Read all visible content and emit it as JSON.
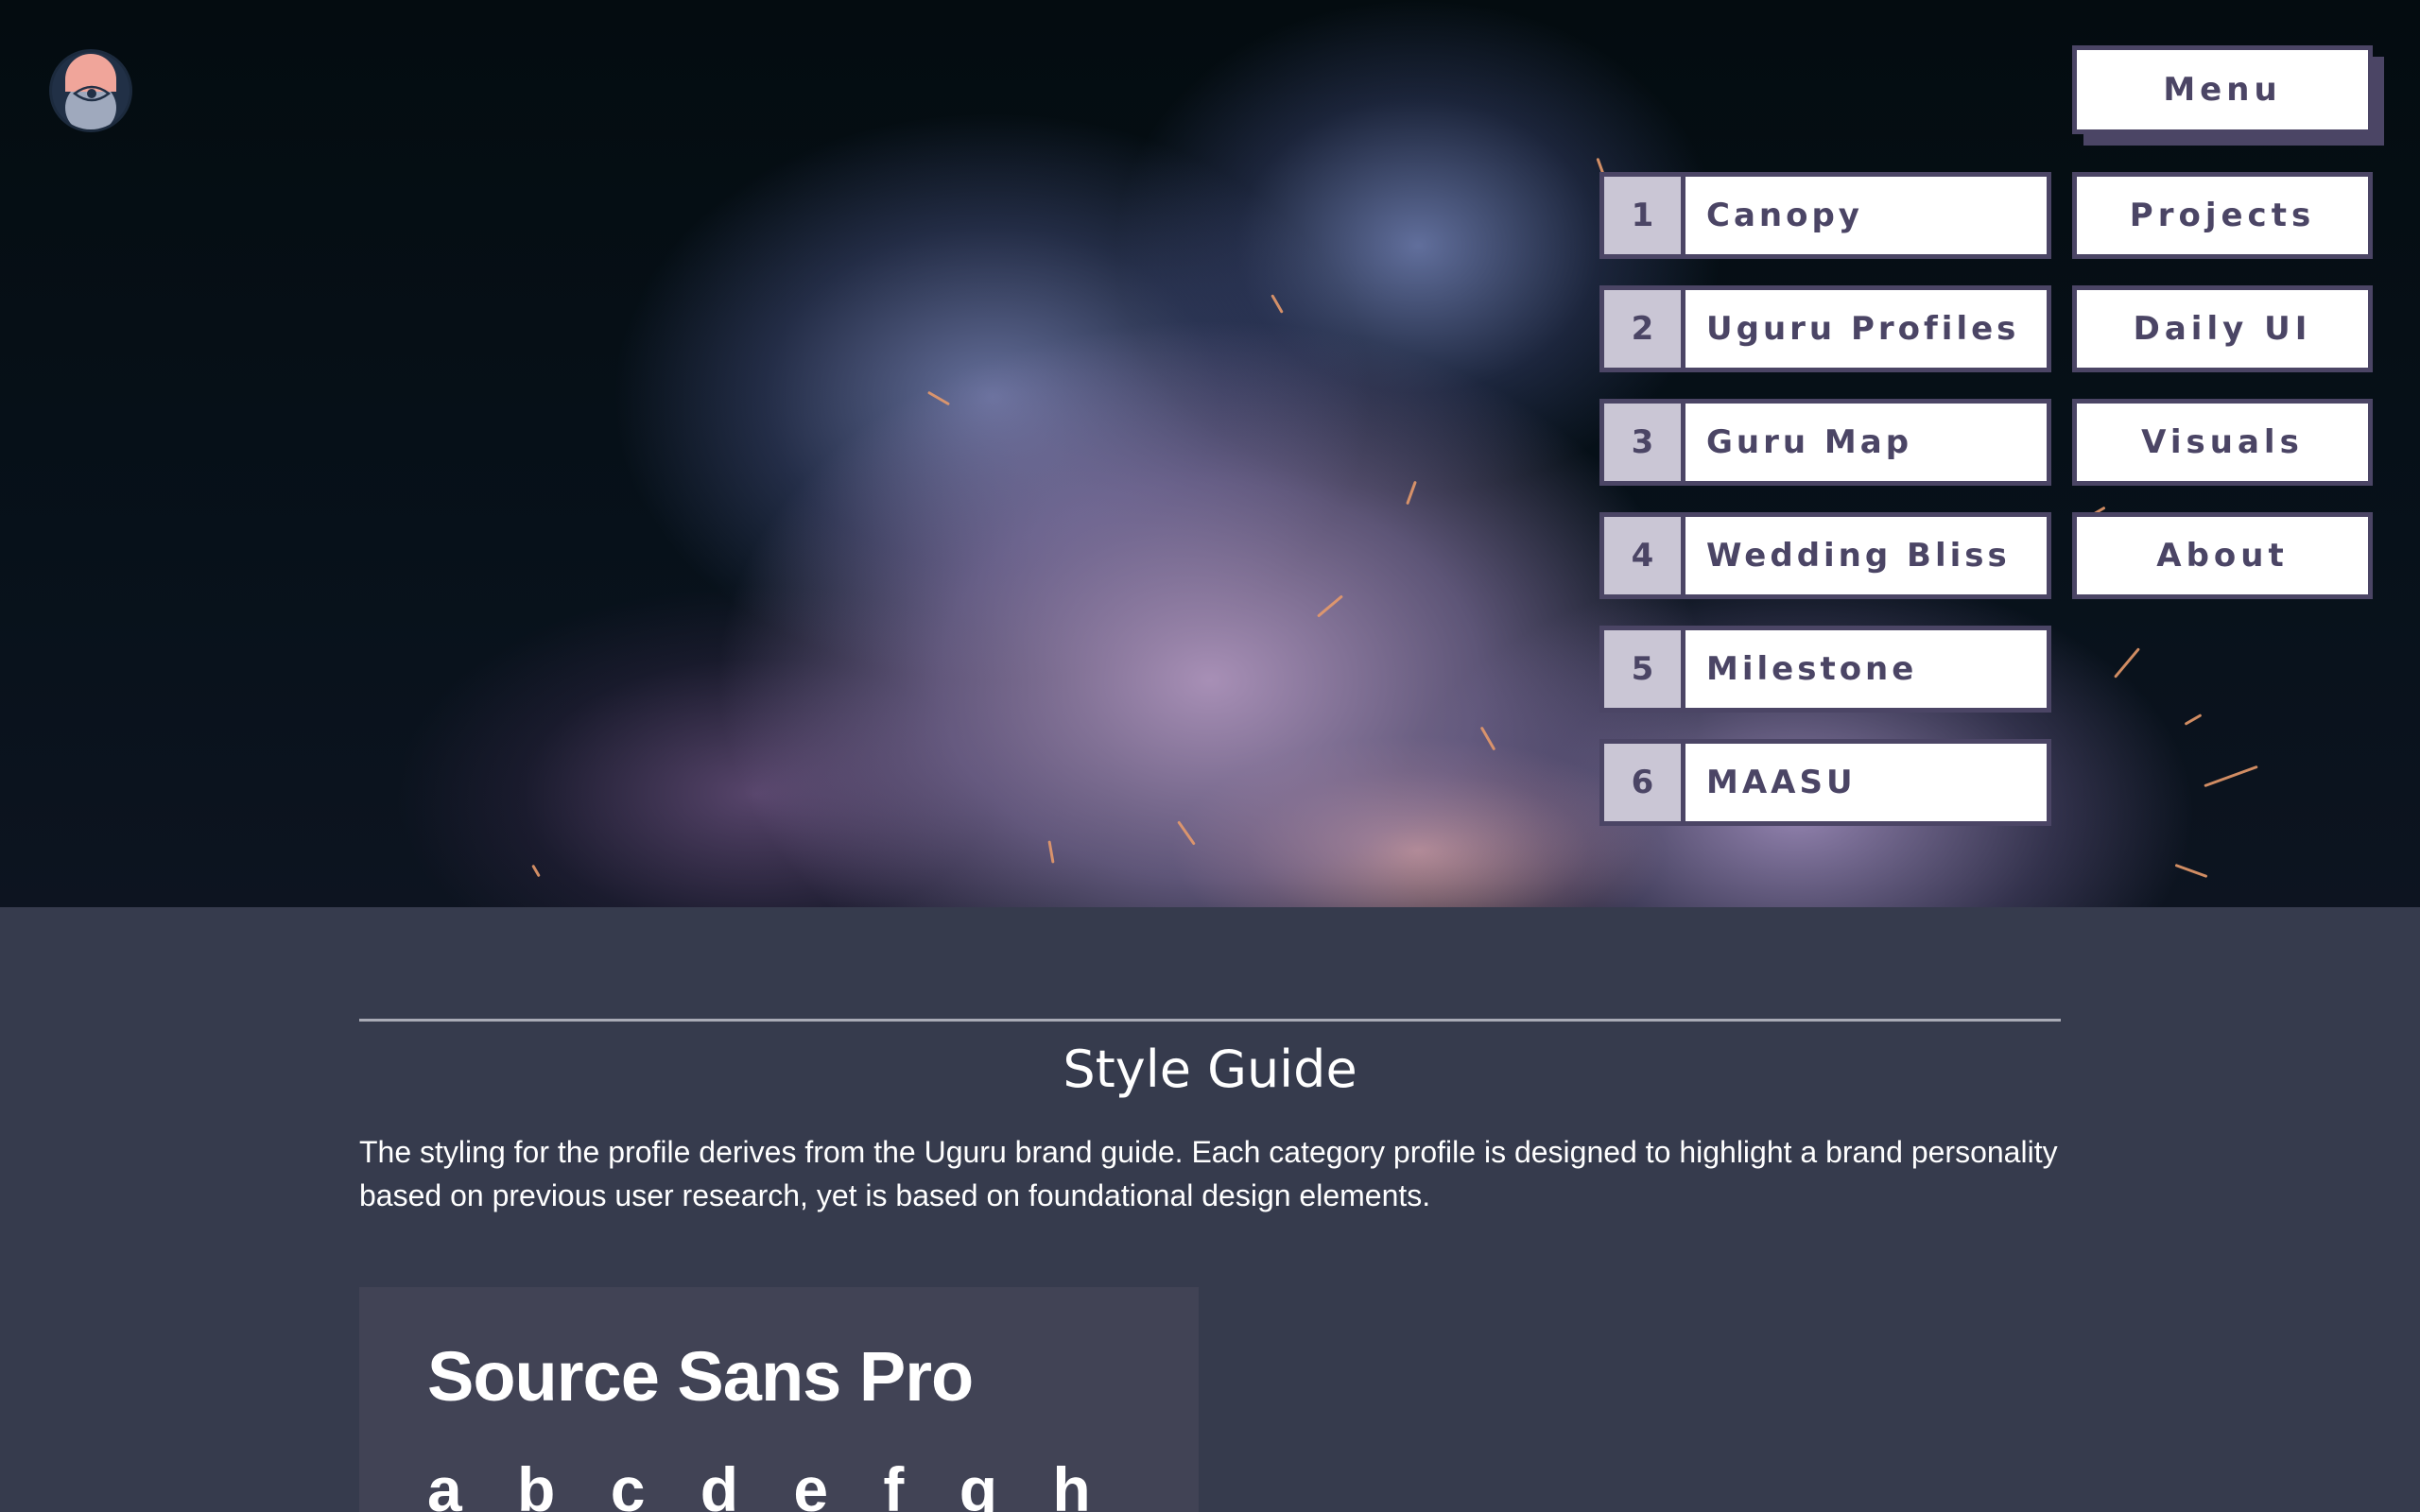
{
  "header": {
    "menu_label": "Menu"
  },
  "projects": [
    {
      "number": "1",
      "label": "Canopy"
    },
    {
      "number": "2",
      "label": "Uguru Profiles"
    },
    {
      "number": "3",
      "label": "Guru Map"
    },
    {
      "number": "4",
      "label": "Wedding Bliss"
    },
    {
      "number": "5",
      "label": "Milestone"
    },
    {
      "number": "6",
      "label": "MAASU"
    }
  ],
  "nav": [
    {
      "label": "Projects"
    },
    {
      "label": "Daily UI"
    },
    {
      "label": "Visuals"
    },
    {
      "label": "About"
    }
  ],
  "content": {
    "title": "Style Guide",
    "description": "The styling for the profile derives from the Uguru brand guide. Each category profile is designed to highlight a brand personality based on previous user research, yet is based on foundational design elements.",
    "typeface_name": "Source Sans Pro",
    "typeface_letters": "a b c d e f g h"
  },
  "colors": {
    "accent": "#4b4565",
    "number_bg": "#cac6d5",
    "page_bg": "#363b4d",
    "card_bg": "#414355",
    "logo_pink": "#f0a59a",
    "logo_blue": "#9fa9bd"
  }
}
